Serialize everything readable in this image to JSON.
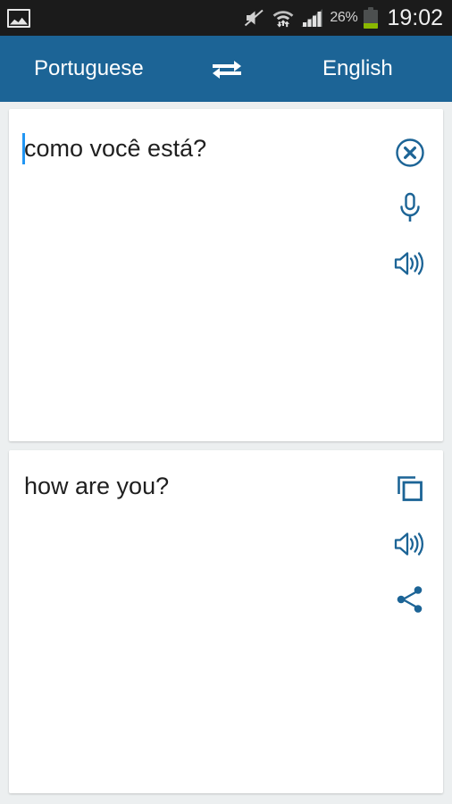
{
  "status_bar": {
    "notification_icon": "gallery-icon",
    "sound_muted_icon": "volume-mute-icon",
    "wifi_icon": "wifi-transfer-icon",
    "signal_icon": "cellular-signal-icon",
    "battery_percent": "26%",
    "battery_icon": "battery-icon",
    "time": "19:02",
    "background_color": "#1b1b1b",
    "text_color": "#d2d2d2"
  },
  "header": {
    "source_language": "Portuguese",
    "target_language": "English",
    "swap_icon": "swap-horizontal-icon",
    "background_color": "#1c6496",
    "text_color": "#ffffff"
  },
  "input_card": {
    "text": "como você está?",
    "caret_visible": true,
    "caret_color": "#2196f3",
    "actions": [
      {
        "name": "clear-button",
        "icon": "close-circle-icon",
        "label": "Clear"
      },
      {
        "name": "voice-input-button",
        "icon": "microphone-icon",
        "label": "Voice input"
      },
      {
        "name": "speak-source-button",
        "icon": "speaker-icon",
        "label": "Listen"
      }
    ]
  },
  "output_card": {
    "text": "how are you?",
    "actions": [
      {
        "name": "copy-button",
        "icon": "copy-icon",
        "label": "Copy"
      },
      {
        "name": "speak-translation-button",
        "icon": "speaker-icon",
        "label": "Listen"
      },
      {
        "name": "share-button",
        "icon": "share-icon",
        "label": "Share"
      }
    ]
  },
  "theme": {
    "accent": "#1c6496",
    "icon_color": "#1c6496",
    "page_background": "#eceff0",
    "card_background": "#ffffff",
    "body_text": "#1f1f1f"
  }
}
